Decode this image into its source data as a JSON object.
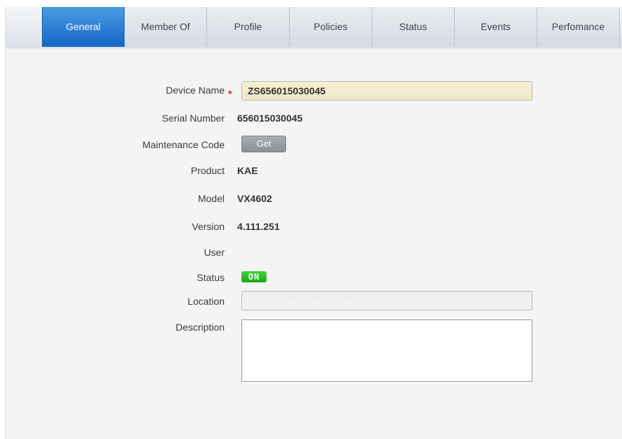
{
  "tabs": [
    {
      "label": "General",
      "active": true
    },
    {
      "label": "Member Of",
      "active": false
    },
    {
      "label": "Profile",
      "active": false
    },
    {
      "label": "Policies",
      "active": false
    },
    {
      "label": "Status",
      "active": false
    },
    {
      "label": "Events",
      "active": false
    },
    {
      "label": "Perfomance",
      "active": false
    }
  ],
  "form": {
    "device_name": {
      "label": "Device Name",
      "required_mark": "*",
      "value": "ZS656015030045"
    },
    "serial_number": {
      "label": "Serial Number",
      "value": "656015030045"
    },
    "maintenance_code": {
      "label": "Maintenance Code",
      "button": "Get"
    },
    "product": {
      "label": "Product",
      "value": "KAE"
    },
    "model": {
      "label": "Model",
      "value": "VX4602"
    },
    "version": {
      "label": "Version",
      "value": "4.111.251"
    },
    "user": {
      "label": "User",
      "value": ""
    },
    "status": {
      "label": "Status",
      "badge": "ON",
      "badge_color": "#22b81f"
    },
    "location": {
      "label": "Location",
      "value": ""
    },
    "description": {
      "label": "Description",
      "value": ""
    }
  },
  "colors": {
    "accent": "#1f74d0",
    "required": "#d9262b"
  }
}
